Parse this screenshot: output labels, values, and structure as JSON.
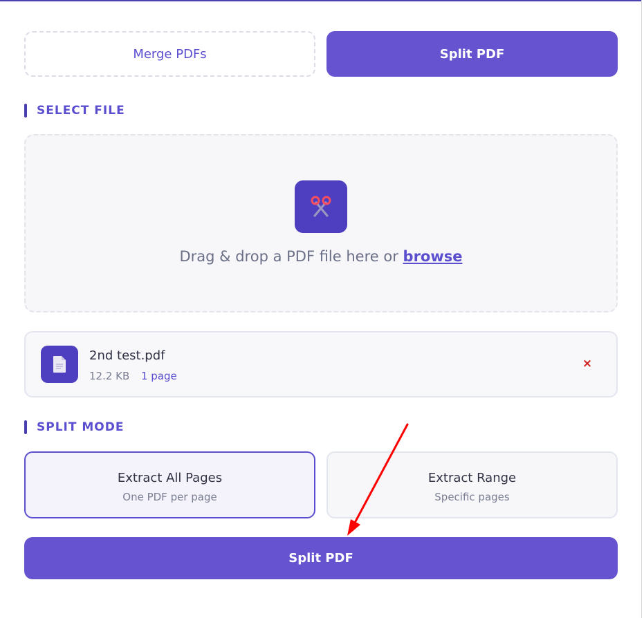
{
  "tabs": {
    "merge_label": "Merge PDFs",
    "split_label": "Split PDF",
    "active": "split"
  },
  "select_file": {
    "title": "SELECT FILE",
    "drop_text": "Drag & drop a PDF file here or",
    "browse_label": "browse",
    "icon": "scissors-icon"
  },
  "file": {
    "name": "2nd test.pdf",
    "size": "12.2 KB",
    "pages": "1 page",
    "icon": "document-icon",
    "remove_label": "×"
  },
  "split_mode": {
    "title": "SPLIT MODE",
    "selected": "extract-all",
    "options": [
      {
        "id": "extract-all",
        "title": "Extract All Pages",
        "subtitle": "One PDF per page"
      },
      {
        "id": "extract-range",
        "title": "Extract Range",
        "subtitle": "Specific pages"
      }
    ]
  },
  "action": {
    "split_button_label": "Split PDF"
  },
  "colors": {
    "accent": "#6553d0",
    "accent_dark": "#4e3fc0",
    "remove": "#d11f1f",
    "annotation_arrow": "#ff0000"
  }
}
